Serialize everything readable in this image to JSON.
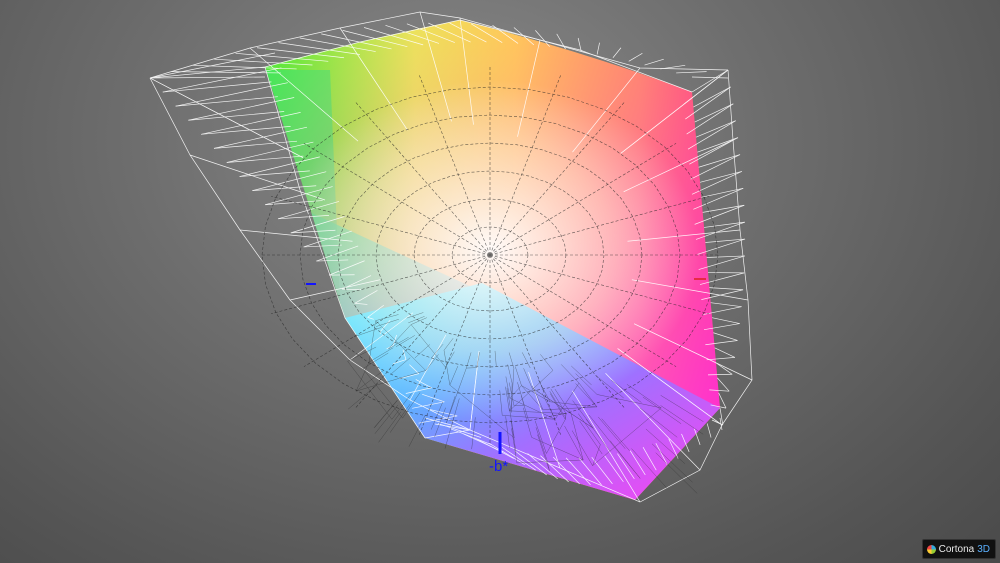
{
  "viewer": {
    "background_color": "#6a6a6a",
    "axis_color": "#1414ff",
    "wire_color": "#ffffff"
  },
  "axes": {
    "minus_b_label": "-b*"
  },
  "watermark": {
    "brand": "Cortona",
    "brand_suffix": "3D"
  }
}
